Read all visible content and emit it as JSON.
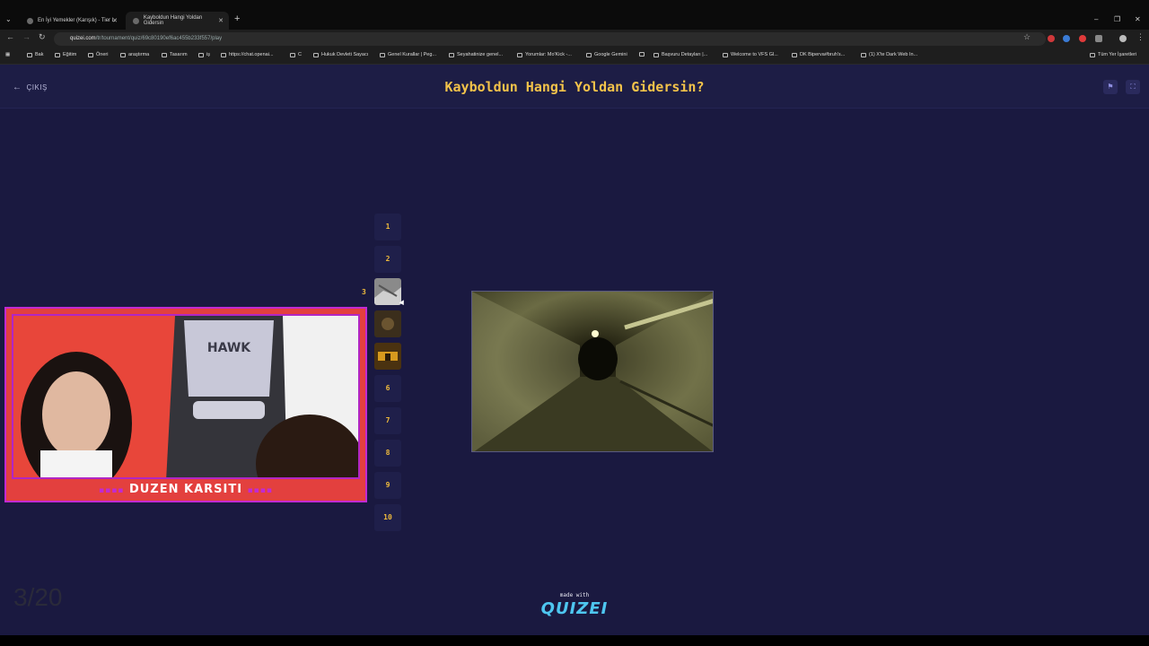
{
  "browser": {
    "tabs": [
      {
        "label": "En İyi Yemekler (Karışık) - Tier L"
      },
      {
        "label": "Kayboldun Hangi Yoldan Gidersin"
      }
    ],
    "url_host": "quizei.com",
    "url_path": "/tr/tournament/quiz/69c80190ef6ac455b233f557/play",
    "bookmarks": [
      "Bak",
      "Eğitim",
      "Öneri",
      "araştırma",
      "Tasarım",
      "iş",
      "https://chat.openai...",
      "C",
      "Hukuk Devleti Sayacı",
      "Genel Kurallar | Peg...",
      "Seyahatinize genel...",
      "Yorumlar: Mo'Kick -...",
      "Google Gemini",
      "Başvuru Detayları |...",
      "Welcome to VFS Gl...",
      "DK Biperva#bruh's...",
      "(1) X'te Dark Web In...",
      "Tüm Yer İşaretleri"
    ]
  },
  "header": {
    "exit_label": "ÇIKIŞ",
    "title": "Kayboldun Hangi Yoldan Gidersin?"
  },
  "bracket": {
    "items": [
      "1",
      "2",
      "3",
      "",
      "",
      "6",
      "7",
      "8",
      "9",
      "10"
    ],
    "current_marker": "3"
  },
  "webcam": {
    "banner": "DUZEN KARSITI",
    "deco_left": "▪▪▪▪",
    "deco_right": "▪▪▪▪"
  },
  "overlay": {
    "counter": "3/20"
  },
  "footer": {
    "made_with": "made with",
    "logo": "QUIZEI"
  }
}
